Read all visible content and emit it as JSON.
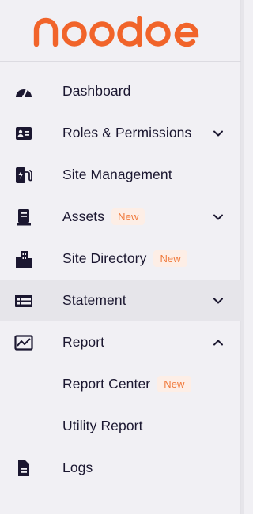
{
  "brand": {
    "logo_text": "noodoe",
    "accent": "#f1642a"
  },
  "nav": {
    "items": [
      {
        "label": "Dashboard",
        "icon": "speedometer-icon"
      },
      {
        "label": "Roles & Permissions",
        "icon": "id-card-icon",
        "expand": "chevron-down"
      },
      {
        "label": "Site Management",
        "icon": "ev-charger-icon"
      },
      {
        "label": "Assets",
        "icon": "server-icon",
        "badge": "New",
        "expand": "chevron-down"
      },
      {
        "label": "Site Directory",
        "icon": "buildings-icon",
        "badge": "New"
      },
      {
        "label": "Statement",
        "icon": "table-icon",
        "expand": "chevron-down",
        "active": true
      },
      {
        "label": "Report",
        "icon": "chart-icon",
        "expand": "chevron-up"
      },
      {
        "label": "Report Center",
        "badge": "New",
        "sub": true
      },
      {
        "label": "Utility Report",
        "sub": true
      },
      {
        "label": "Logs",
        "icon": "document-icon"
      }
    ]
  },
  "colors": {
    "badge_bg": "#fdeee6",
    "badge_text": "#f07a3c",
    "active_bg": "#e6e5ea"
  }
}
